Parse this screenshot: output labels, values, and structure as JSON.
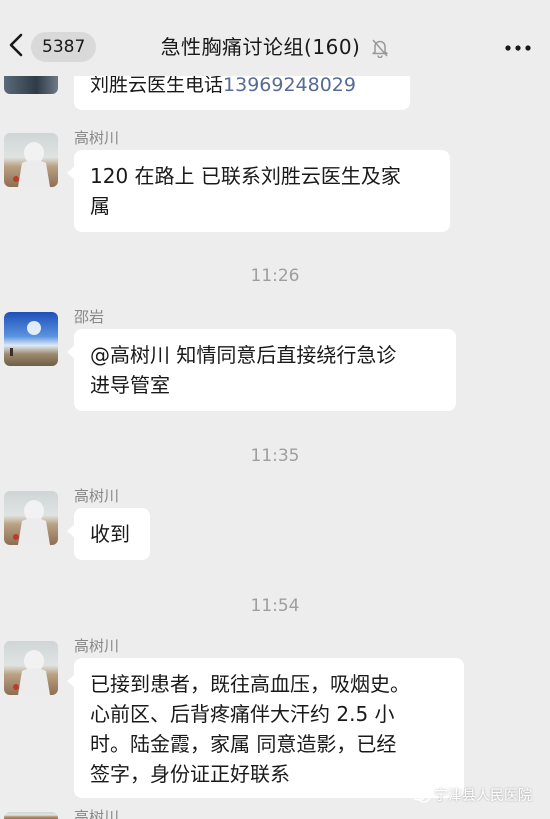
{
  "header": {
    "back_badge": "5387",
    "title": "急性胸痛讨论组(160)",
    "mute_icon": "bell-off-icon",
    "more_icon": "more-dots-icon"
  },
  "colors": {
    "background": "#ededed",
    "bubble": "#ffffff",
    "link": "#576b95",
    "meta_text": "#9e9e9e"
  },
  "partial_message": {
    "text": "刘胜云医生电话",
    "phone": "13969248029"
  },
  "messages": [
    {
      "sender": "高树川",
      "lines": [
        "120 在路上  已联系刘胜云医生及家",
        "属"
      ]
    },
    {
      "sender": "邵岩",
      "lines": [
        "@高树川 知情同意后直接绕行急诊",
        "进导管室"
      ]
    },
    {
      "sender": "高树川",
      "lines": [
        "收到"
      ]
    },
    {
      "sender": "高树川",
      "lines": [
        "已接到患者，既往高血压，吸烟史。",
        "心前区、后背疼痛伴大汗约 2.5 小",
        "时。陆金霞，家属 同意造影，已经",
        "签字，身份证正好联系"
      ]
    },
    {
      "sender": "高树川"
    }
  ],
  "timestamps": [
    "11:26",
    "11:35",
    "11:54"
  ],
  "watermark": "宁津县人民医院"
}
